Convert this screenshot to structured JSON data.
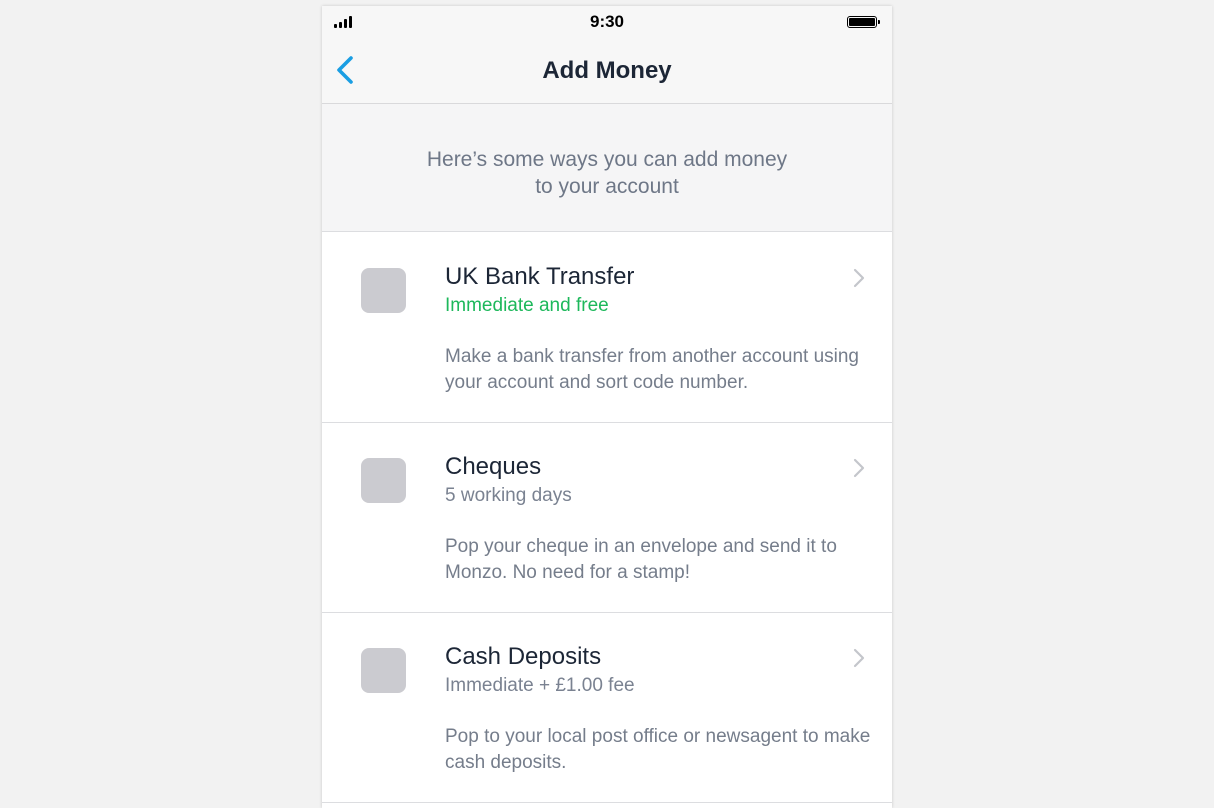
{
  "status_bar": {
    "time": "9:30",
    "signal_icon": "signal-bars-icon",
    "battery_icon": "battery-icon"
  },
  "nav": {
    "title": "Add Money",
    "back_icon": "chevron-left-icon"
  },
  "intro": {
    "line1": "Here’s some ways you can add money",
    "line2": "to your account"
  },
  "options": [
    {
      "title": "UK Bank Transfer",
      "subtitle": "Immediate and free",
      "description": "Make a bank transfer from another account using your account and sort code number."
    },
    {
      "title": "Cheques",
      "subtitle": "5 working days",
      "description": "Pop your cheque in an envelope and send it to Monzo. No need for a stamp!"
    },
    {
      "title": "Cash Deposits",
      "subtitle": "Immediate + £1.00 fee",
      "description": "Pop to your local post office or newsagent to make cash deposits."
    }
  ],
  "colors": {
    "accent": "#1a9ee3",
    "positive": "#1db85b",
    "title_text": "#1c2636",
    "secondary_text": "#757d8b",
    "icon_placeholder": "#cbcbd0"
  }
}
